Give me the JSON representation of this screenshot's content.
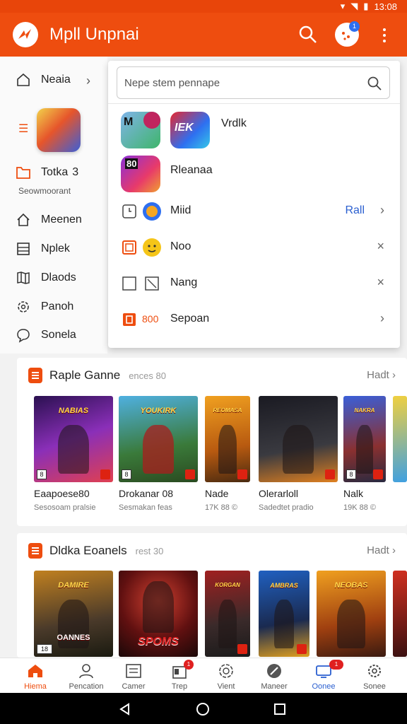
{
  "status_bar": {
    "time": "13:08"
  },
  "header": {
    "title": "Mpll Unpnai",
    "notification_count": "1"
  },
  "sidebar": {
    "items": [
      {
        "label": "Neaia",
        "icon": "home-icon"
      },
      {
        "label": "Totka",
        "count": "3",
        "icon": "folder-icon"
      },
      {
        "label": "Meenen",
        "icon": "home-outline-icon"
      },
      {
        "label": "Nplek",
        "icon": "list-icon"
      },
      {
        "label": "Dlaods",
        "icon": "map-icon"
      },
      {
        "label": "Panoh",
        "icon": "gear-icon"
      },
      {
        "label": "Sonela",
        "icon": "chat-icon"
      }
    ],
    "subtext": "Seowmoorant"
  },
  "dropdown": {
    "search_placeholder": "Nepe stem pennape",
    "rows": [
      {
        "label": "Vrdlk",
        "icon_text": "IEK",
        "small_icon_text": "M"
      },
      {
        "label": "Rleanaa",
        "icon_text": "80"
      },
      {
        "label": "Miid",
        "extra": "Rall"
      },
      {
        "label": "Noo"
      },
      {
        "label": "Nang"
      },
      {
        "label": "Sepoan",
        "prefix": "800"
      }
    ]
  },
  "sections": [
    {
      "title": "Raple Ganne",
      "subtitle": "ences 80",
      "more": "Hadt",
      "cards": [
        {
          "title": "Eaapoese80",
          "sub": "Sesosoam pralsie",
          "banner": "NABIAS",
          "tag": "8"
        },
        {
          "title": "Drokanar 08",
          "sub": "Sesmakan feas",
          "banner": "YOUKIRK",
          "tag": "8"
        },
        {
          "title": "Nade",
          "sub": "17K 88 ©",
          "banner": "REOMASA",
          "tag": ""
        },
        {
          "title": "Olerarloll",
          "sub": "Sadedtet pradio",
          "banner": "",
          "tag": ""
        },
        {
          "title": "Nalk",
          "sub": "19K 88 ©",
          "banner": "NAKRA",
          "tag": "8"
        }
      ]
    },
    {
      "title": "Dldka Eoanels",
      "subtitle": "rest 30",
      "more": "Hadt",
      "cards": [
        {
          "title": "",
          "sub": "",
          "banner": "DAMIRE",
          "tag": "18",
          "sub_banner": "OANNES"
        },
        {
          "title": "",
          "sub": "",
          "banner": "SPOMS",
          "tag": ""
        },
        {
          "title": "",
          "sub": "",
          "banner": "KORGAN",
          "tag": ""
        },
        {
          "title": "",
          "sub": "",
          "banner": "AMBRAS",
          "tag": ""
        },
        {
          "title": "",
          "sub": "",
          "banner": "NEOBAS",
          "tag": ""
        }
      ]
    }
  ],
  "bottom_nav": [
    {
      "label": "Hiema",
      "icon": "home-icon",
      "active": true
    },
    {
      "label": "Pencation",
      "icon": "person-icon"
    },
    {
      "label": "Camer",
      "icon": "list-icon"
    },
    {
      "label": "Trep",
      "icon": "bag-icon",
      "badge": "1"
    },
    {
      "label": "Vient",
      "icon": "globe-icon"
    },
    {
      "label": "Maneer",
      "icon": "pen-icon"
    },
    {
      "label": "Oonee",
      "icon": "tv-icon",
      "badge": "1"
    },
    {
      "label": "Sonee",
      "icon": "gear-icon"
    }
  ],
  "colors": {
    "accent": "#ee4d0f",
    "link": "#2a5fd0"
  }
}
